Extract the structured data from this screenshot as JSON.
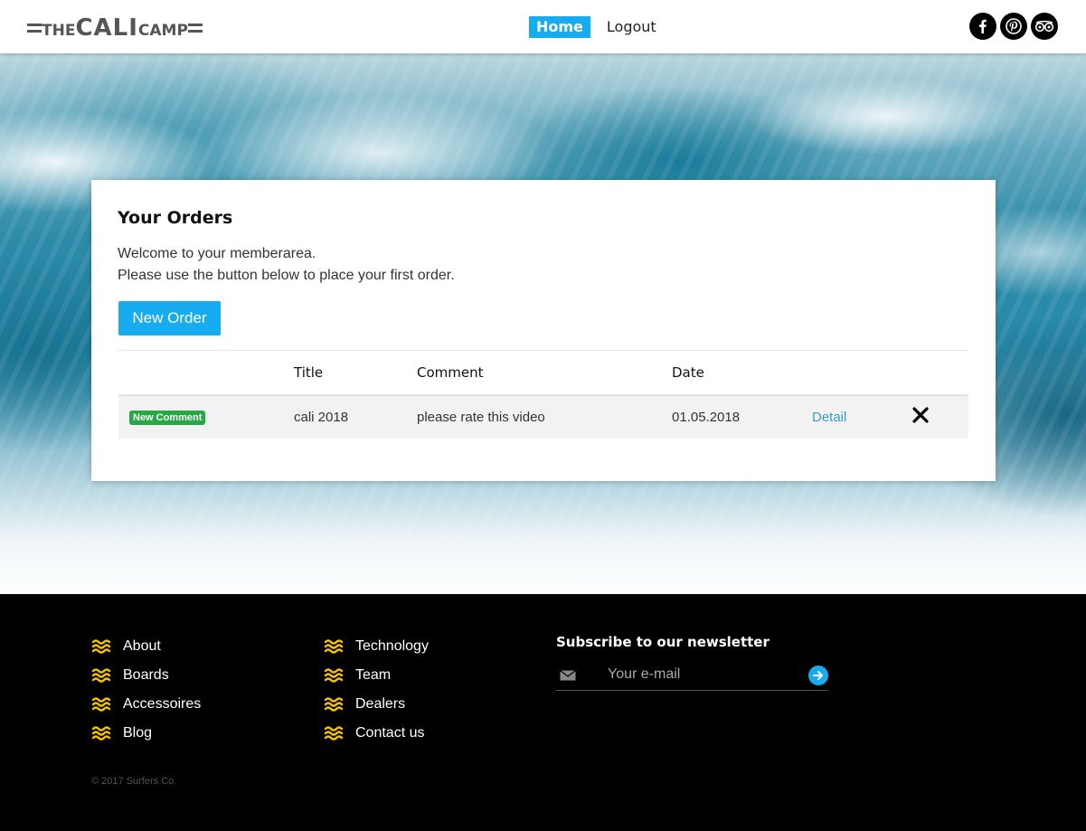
{
  "header": {
    "logo": {
      "the": "THE",
      "cali": "CALI",
      "camp": "CAMP"
    },
    "nav": [
      {
        "label": "Home",
        "active": true
      },
      {
        "label": "Logout",
        "active": false
      }
    ],
    "social": [
      "facebook-icon",
      "pinterest-icon",
      "tripadvisor-icon"
    ]
  },
  "card": {
    "title": "Your Orders",
    "welcome": "Welcome to your memberarea.",
    "instruction": "Please use the button below to place your first order.",
    "new_order_label": "New Order",
    "table": {
      "headers": [
        "",
        "Title",
        "Comment",
        "Date",
        "",
        ""
      ],
      "rows": [
        {
          "badge": "New Comment",
          "title": "cali 2018",
          "comment": "please rate this video",
          "date": "01.05.2018",
          "detail": "Detail"
        }
      ]
    }
  },
  "footer": {
    "col1": [
      "About",
      "Boards",
      "Accessoires",
      "Blog"
    ],
    "col2": [
      "Technology",
      "Team",
      "Dealers",
      "Contact us"
    ],
    "newsletter": {
      "title": "Subscribe to our newsletter",
      "placeholder": "Your e-mail"
    },
    "copyright": "© 2017 Surfers Co."
  },
  "colors": {
    "accent": "#17abf0",
    "badge": "#28a745",
    "wave_icon": "#f2c200",
    "footer_bg": "#000000"
  }
}
